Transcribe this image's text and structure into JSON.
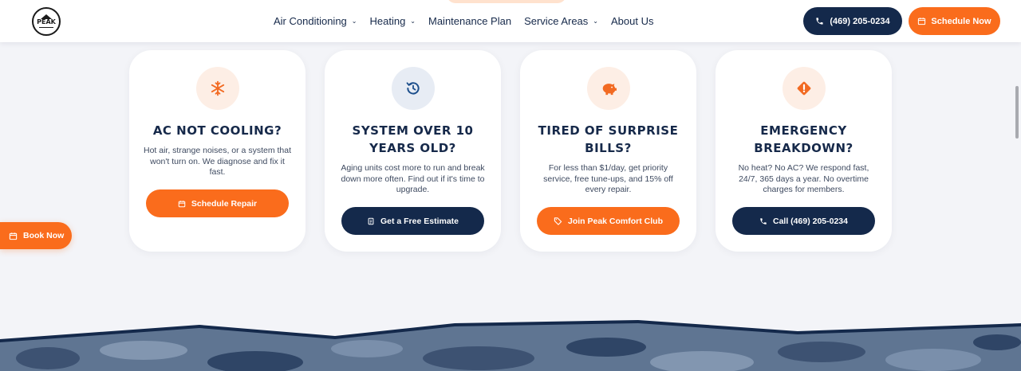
{
  "header": {
    "logo_text": "PEAK",
    "nav": [
      {
        "label": "Air Conditioning",
        "has_dropdown": true
      },
      {
        "label": "Heating",
        "has_dropdown": true
      },
      {
        "label": "Maintenance Plan",
        "has_dropdown": false
      },
      {
        "label": "Service Areas",
        "has_dropdown": true
      },
      {
        "label": "About Us",
        "has_dropdown": false
      }
    ],
    "phone_button": "(469) 205-0234",
    "schedule_button": "Schedule Now"
  },
  "cards": [
    {
      "icon": "snowflake-icon",
      "title": "AC NOT COOLING?",
      "body": "Hot air, strange noises, or a system that won't turn on. We diagnose and fix it fast.",
      "button": "Schedule Repair",
      "button_icon": "calendar-icon",
      "button_style": "orange"
    },
    {
      "icon": "clock-history-icon",
      "title": "SYSTEM OVER 10 YEARS OLD?",
      "body": "Aging units cost more to run and break down more often. Find out if it's time to upgrade.",
      "button": "Get a Free Estimate",
      "button_icon": "document-icon",
      "button_style": "navy"
    },
    {
      "icon": "piggy-bank-icon",
      "title": "TIRED OF SURPRISE BILLS?",
      "body": "For less than $1/day, get priority service, free tune-ups, and 15% off every repair.",
      "button": "Join Peak Comfort Club",
      "button_icon": "tag-icon",
      "button_style": "orange"
    },
    {
      "icon": "warning-icon",
      "title": "EMERGENCY BREAKDOWN?",
      "body": "No heat? No AC? We respond fast, 24/7, 365 days a year. No overtime charges for members.",
      "button": "Call (469) 205-0234",
      "button_icon": "phone-icon",
      "button_style": "navy"
    }
  ],
  "book_now": "Book Now",
  "colors": {
    "navy": "#14294b",
    "orange": "#fa6c1c",
    "page_bg": "#f3f4f8"
  }
}
